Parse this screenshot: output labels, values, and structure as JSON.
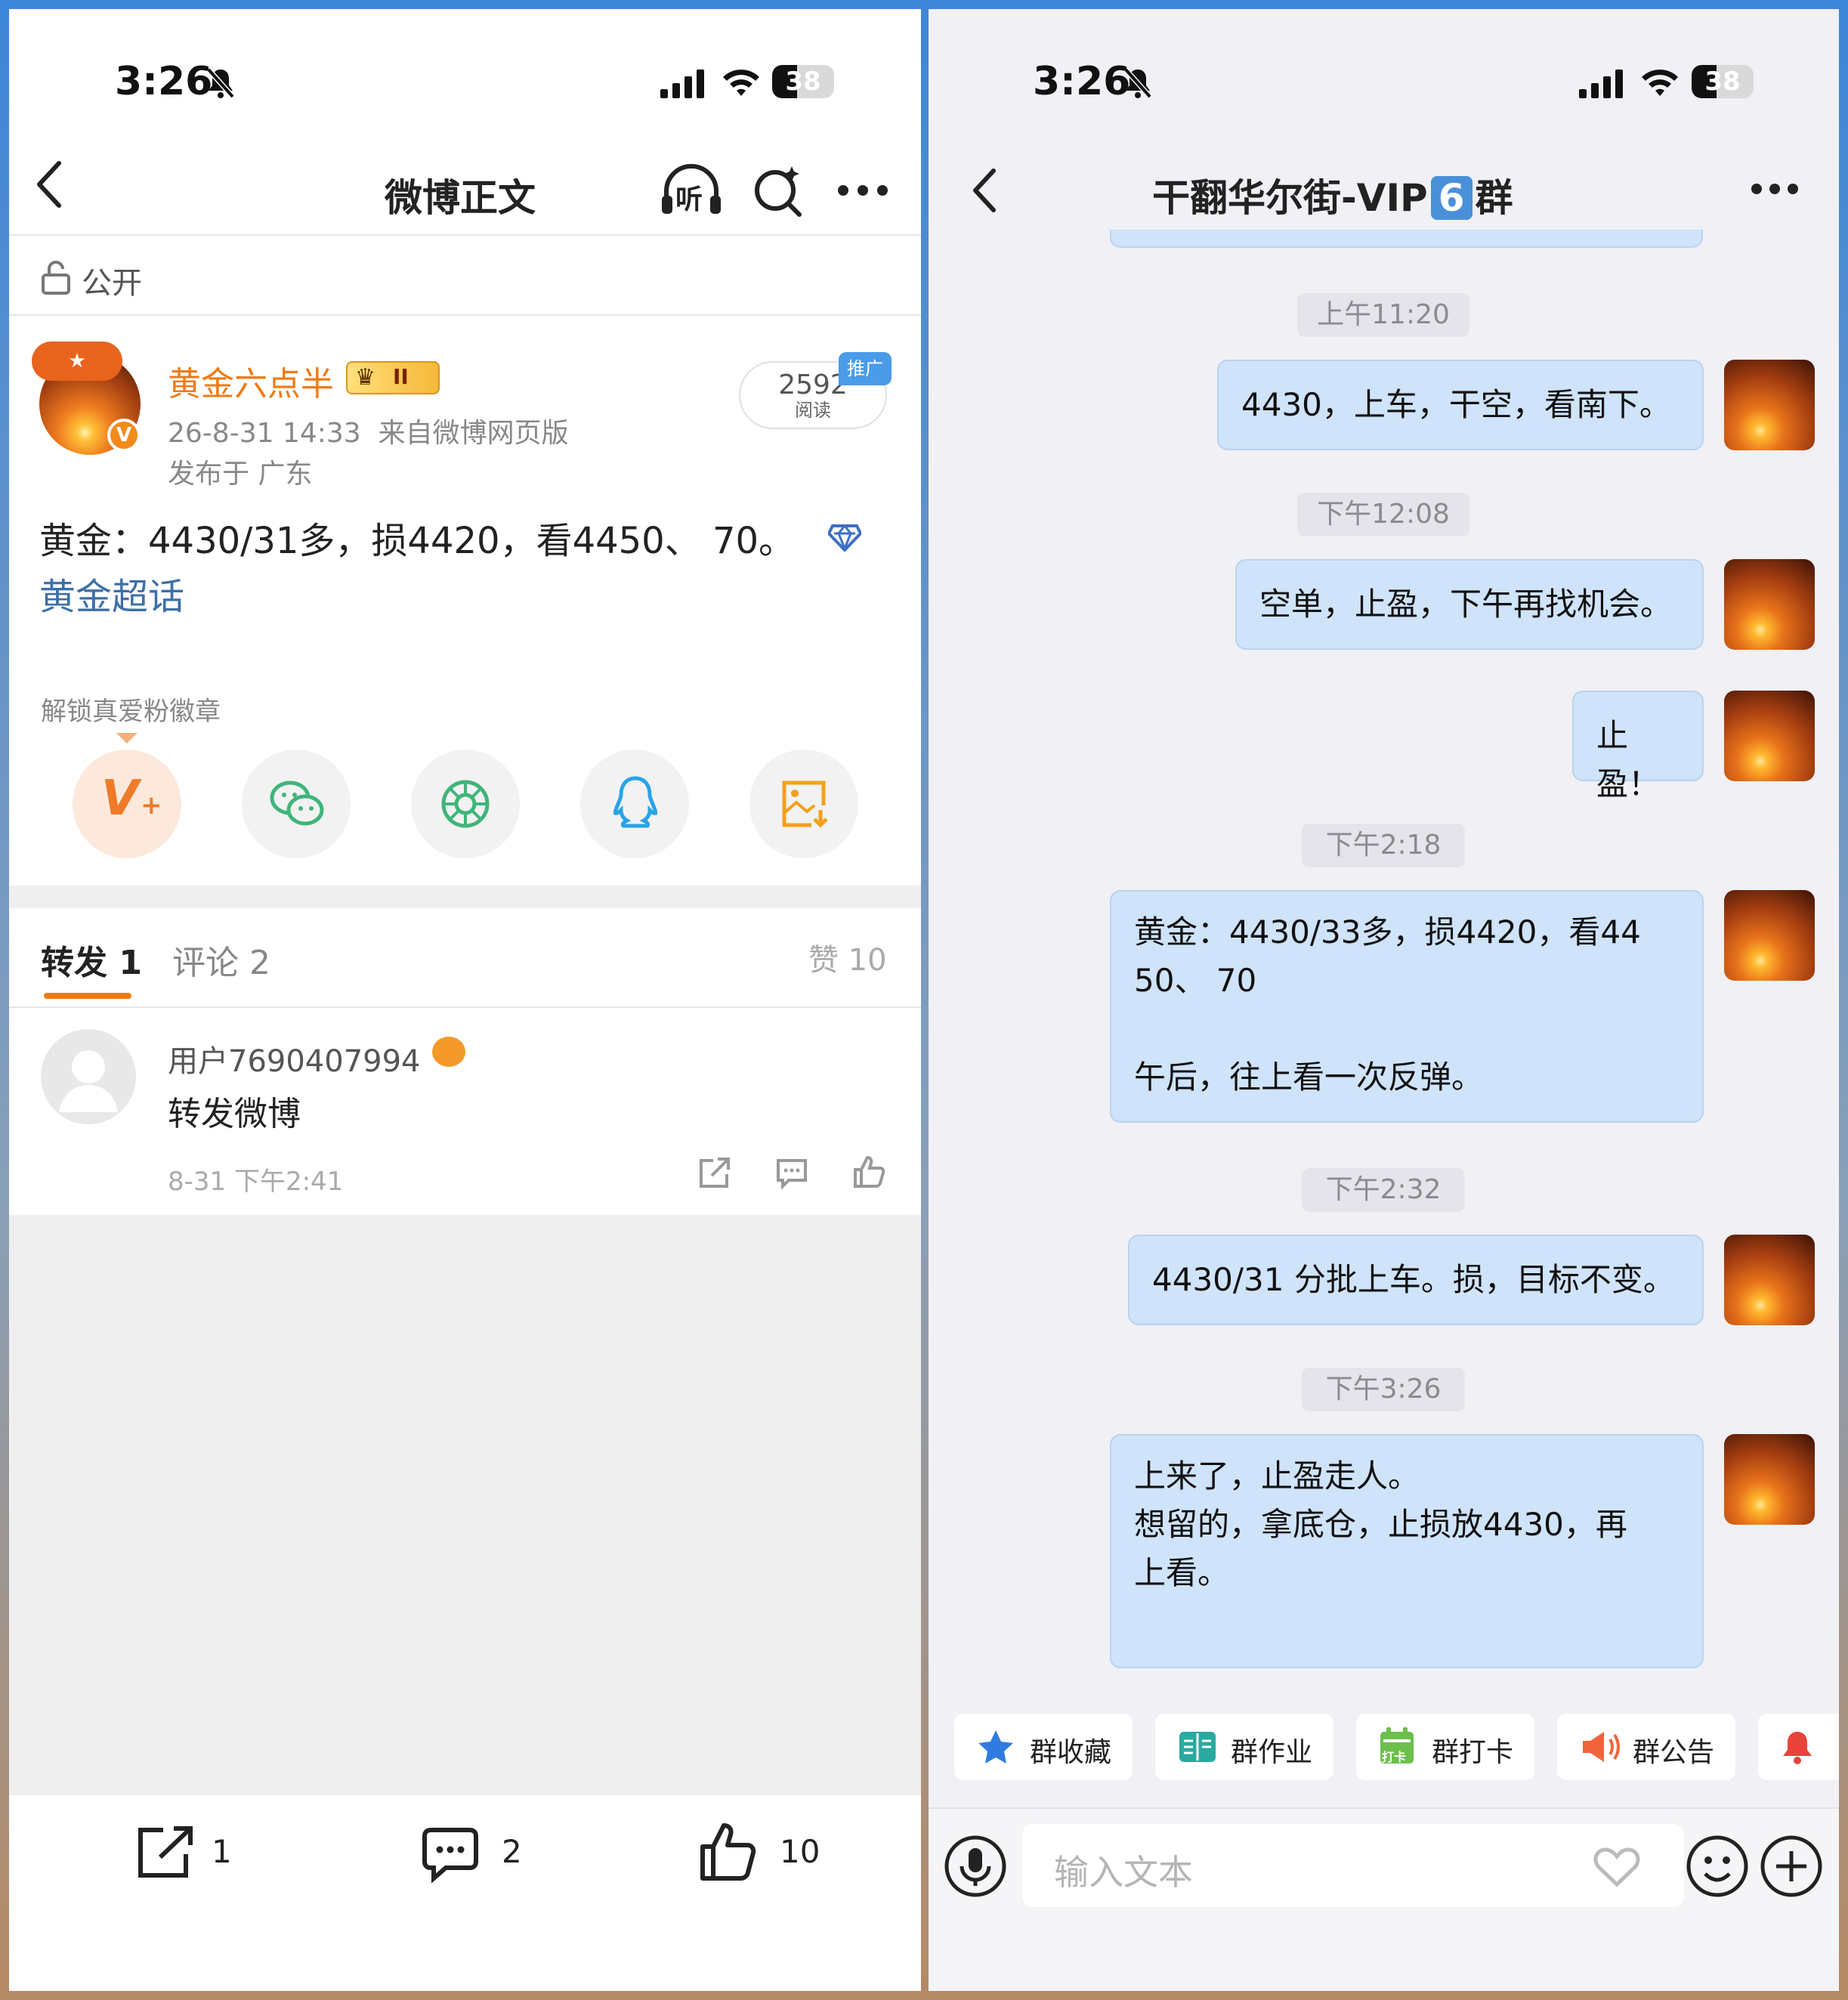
{
  "left": {
    "status": {
      "time": "3:26",
      "battery": "38"
    },
    "nav": {
      "title": "微博正文",
      "listen": "听"
    },
    "visibility": "公开",
    "post": {
      "author": "黄金六点半",
      "level": "II",
      "time": "26-8-31 14:33",
      "source": "来自微博网页版",
      "location": "发布于 广东",
      "reads": "2592",
      "reads_label": "阅读",
      "promo": "推广",
      "text": "黄金：4430/31多，损4420，看4450、 70。",
      "topic": "黄金超话"
    },
    "badge_hint": "解锁真爱粉徽章",
    "share_icons": [
      "vplus-icon",
      "wechat-icon",
      "moments-icon",
      "qq-icon",
      "save-image-icon"
    ],
    "tabs": {
      "repost": "转发",
      "repost_count": "1",
      "comment": "评论",
      "comment_count": "2",
      "like": "赞",
      "like_count": "10"
    },
    "repost_item": {
      "user": "用户7690407994",
      "text": "转发微博",
      "time": "8-31 下午2:41"
    },
    "bottom": {
      "repost": "1",
      "comment": "2",
      "like": "10"
    }
  },
  "right": {
    "status": {
      "time": "3:26",
      "battery": "38"
    },
    "nav": {
      "title": "干翻华尔街-VIP",
      "badge": "6",
      "suffix": "群"
    },
    "messages": [
      {
        "time": "上午11:20",
        "lines": [
          "4430，上车，干空，看南下。"
        ]
      },
      {
        "time": "下午12:08",
        "lines": [
          "空单，止盈，下午再找机会。"
        ]
      },
      {
        "time": "",
        "lines": [
          "止盈！"
        ]
      },
      {
        "time": "下午2:18",
        "lines": [
          "黄金：4430/33多，损4420，看44",
          "50、 70",
          "",
          "午后，往上看一次反弹。"
        ]
      },
      {
        "time": "下午2:32",
        "lines": [
          "4430/31 分批上车。损，目标不变。"
        ]
      },
      {
        "time": "下午3:26",
        "lines": [
          "上来了，止盈走人。",
          "想留的，拿底仓，止损放4430，再",
          "上看。"
        ]
      }
    ],
    "chips": [
      "群收藏",
      "群作业",
      "群打卡",
      "群公告"
    ],
    "checkin_tag": "打卡",
    "input_placeholder": "输入文本"
  }
}
